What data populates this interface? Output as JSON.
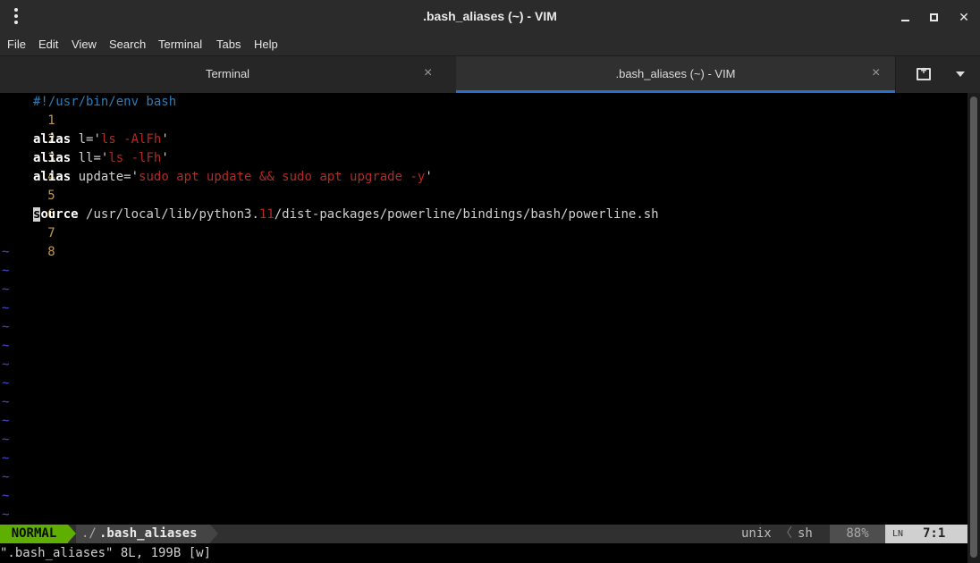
{
  "window": {
    "title": ".bash_aliases (~) - VIM"
  },
  "menubar": {
    "items": [
      "File",
      "Edit",
      "View",
      "Search",
      "Terminal",
      "Tabs",
      "Help"
    ]
  },
  "tabs": [
    {
      "label": "Terminal",
      "active": false
    },
    {
      "label": ".bash_aliases (~) - VIM",
      "active": true
    }
  ],
  "editor": {
    "line_numbers": [
      "1",
      "2",
      "3",
      "4",
      "5",
      "6",
      "7",
      "8"
    ],
    "lines": [
      {
        "shebang": "#!/usr/bin/env bash"
      },
      {},
      {
        "kw": "alias",
        "pre": " l=",
        "q1": "'",
        "str": "ls -AlFh",
        "q2": "'"
      },
      {
        "kw": "alias",
        "pre": " ll=",
        "q1": "'",
        "str": "ls -lFh",
        "q2": "'"
      },
      {
        "kw": "alias",
        "pre": " update=",
        "q1": "'",
        "str": "sudo apt update && sudo apt upgrade -y",
        "q2": "'"
      },
      {},
      {
        "cursor_char": "s",
        "kw": "ource",
        "pre": " /usr/local/lib/python3.",
        "num": "11",
        "post": "/dist-packages/powerline/bindings/bash/powerline.sh"
      },
      {}
    ],
    "tilde": "~"
  },
  "statusline": {
    "mode": "NORMAL",
    "dir": "./",
    "filename": ".bash_aliases",
    "fileformat": "unix",
    "sep": "〈",
    "filetype": "sh",
    "percent": "88%",
    "line_icon": "LN",
    "position": "7:1"
  },
  "cmdline": "\".bash_aliases\" 8L, 199B [w]",
  "colors": {
    "mode_bg": "#5faf00",
    "tab_underline": "#2d6fc7",
    "string": "#b22a22",
    "comment": "#2f7db5",
    "line_number": "#c59848",
    "tilde": "#4a4ad8"
  }
}
